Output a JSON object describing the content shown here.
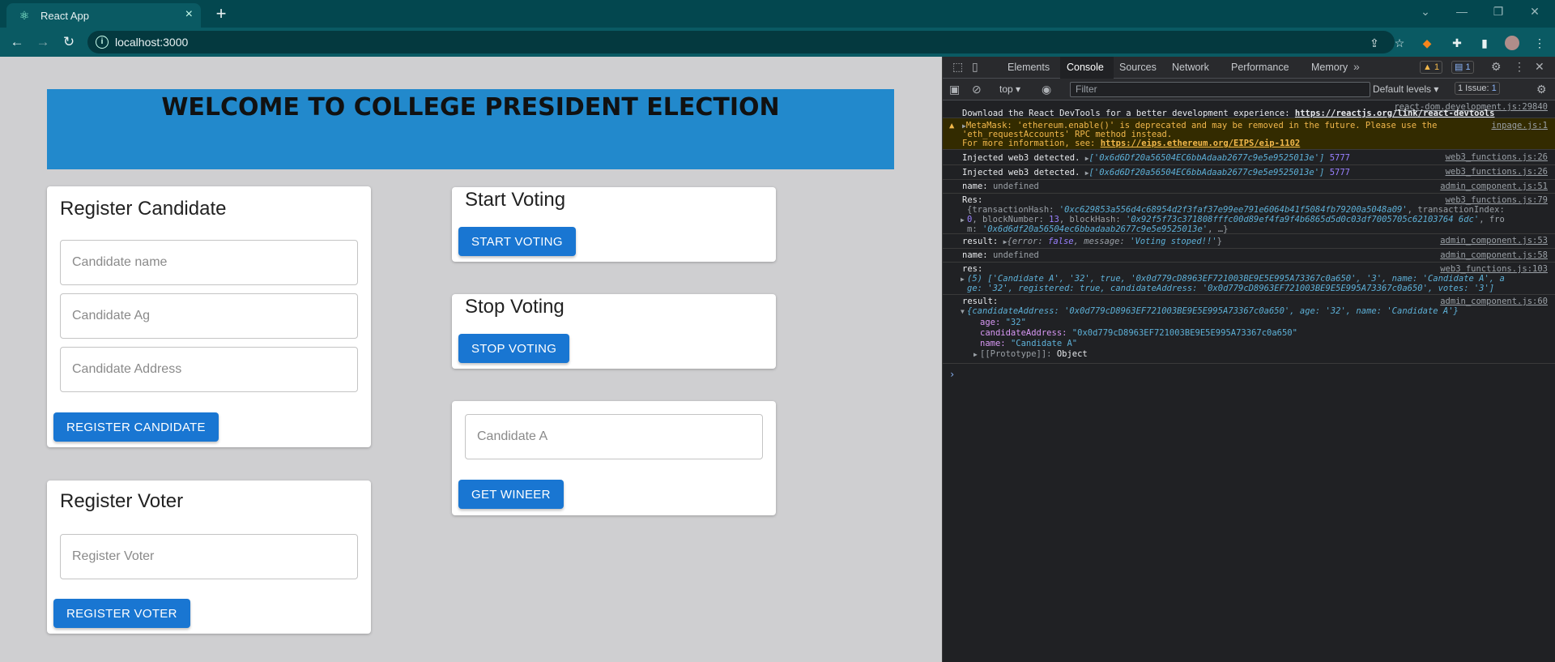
{
  "browser": {
    "tab_title": "React App",
    "url": "localhost:3000"
  },
  "page": {
    "heading": "WELCOME TO COLLEGE PRESIDENT ELECTION",
    "register_candidate": {
      "title": "Register Candidate",
      "name_placeholder": "Candidate name",
      "age_placeholder": "Candidate Ag",
      "address_placeholder": "Candidate Address",
      "button": "REGISTER CANDIDATE"
    },
    "register_voter": {
      "title": "Register Voter",
      "placeholder": "Register Voter",
      "button": "REGISTER VOTER"
    },
    "start_voting": {
      "title": "Start Voting",
      "button": "START VOTING"
    },
    "stop_voting": {
      "title": "Stop Voting",
      "button": "STOP VOTING"
    },
    "winner": {
      "value": "Candidate A",
      "button": "GET WINEER"
    }
  },
  "devtools": {
    "tabs": [
      "Elements",
      "Console",
      "Sources",
      "Network",
      "Performance",
      "Memory"
    ],
    "active_tab": "Console",
    "warnings_count": "1",
    "messages_count": "1",
    "context": "top",
    "filter_placeholder": "Filter",
    "levels": "Default levels",
    "issues": "1 Issue:",
    "issues_count": "1",
    "console": {
      "m1_src": "react-dom.development.js:29840",
      "m1_text": "Download the React DevTools for a better development experience: ",
      "m1_link": "https://reactjs.org/link/react-devtools",
      "m2_src": "inpage.js:1",
      "m2_l1": "MetaMask: 'ethereum.enable()' is deprecated and may be removed in the future. Please use the",
      "m2_l2": "'eth_requestAccounts' RPC method instead.",
      "m2_l3": "For more information, see: ",
      "m2_link": "https://eips.ethereum.org/EIPS/eip-1102",
      "m3_text": "Injected web3 detected.",
      "m3_addr": "['0x6d6Df20a56504EC6bbAdaab2677c9e5e9525013e']",
      "m3_num": "5777",
      "m3_src": "web3_functions.js:26",
      "m4_src": "web3_functions.js:26",
      "m5_label": "name:",
      "m5_val": "undefined",
      "m5_src": "admin_component.js:51",
      "m6_label": "Res:",
      "m6_src": "web3_functions.js:79",
      "m6_l1a": "{transactionHash: ",
      "m6_l1b": "'0xc629853a556d4c68954d2f3faf37e99ee791e6064b41f5084fb79200a5048a09'",
      "m6_l1c": ", transactionIndex:",
      "m6_l2a": "0",
      "m6_l2b": ", blockNumber: ",
      "m6_l2c": "13",
      "m6_l2d": ", blockHash: ",
      "m6_l2e": "'0x92f5f73c371808fffc00d89ef4fa9f4b6865d5d0c03df7005705c62103764 6dc'",
      "m6_l2f": ", fro",
      "m6_l3a": "m: ",
      "m6_l3b": "'0x6d6df20a56504ec6bbadaab2677c9e5e9525013e'",
      "m6_l3c": ", …}",
      "m7_label": "result:",
      "m7_a": "{error: ",
      "m7_b": "false",
      "m7_c": ", message: ",
      "m7_d": "'Voting stoped!!'",
      "m7_e": "}",
      "m7_src": "admin_component.js:53",
      "m8_label": "name:",
      "m8_val": "undefined",
      "m8_src": "admin_component.js:58",
      "m9_label": "res:",
      "m9_src": "web3_functions.js:103",
      "m9_l1": "(5) ['Candidate A', '32', true, '0x0d779cD8963EF721003BE9E5E995A73367c0a650', '3', name: 'Candidate A', a",
      "m9_l2": "ge: '32', registered: true, candidateAddress: '0x0d779cD8963EF721003BE9E5E995A73367c0a650', votes: '3']",
      "m10_label": "result:",
      "m10_src": "admin_component.js:60",
      "m10_l1": "{candidateAddress: '0x0d779cD8963EF721003BE9E5E995A73367c0a650', age: '32', name: 'Candidate A'}",
      "m10_age_k": "age: ",
      "m10_age_v": "\"32\"",
      "m10_addr_k": "candidateAddress: ",
      "m10_addr_v": "\"0x0d779cD8963EF721003BE9E5E995A73367c0a650\"",
      "m10_name_k": "name: ",
      "m10_name_v": "\"Candidate A\"",
      "m10_proto_k": "[[Prototype]]: ",
      "m10_proto_v": "Object"
    }
  }
}
